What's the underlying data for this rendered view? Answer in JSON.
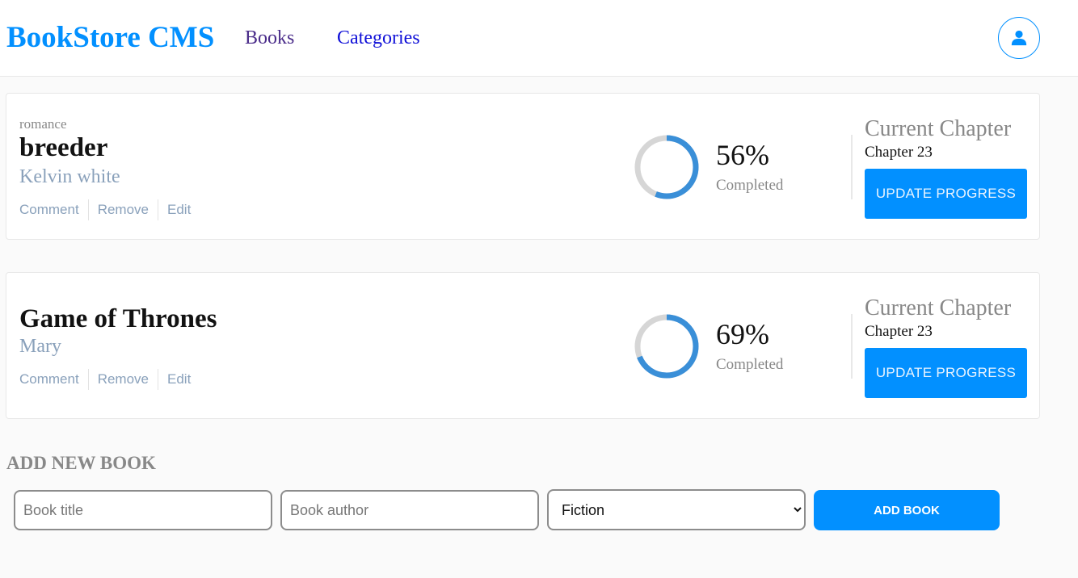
{
  "header": {
    "logo": "BookStore CMS",
    "nav": [
      {
        "label": "Books"
      },
      {
        "label": "Categories"
      }
    ],
    "user_icon": "user-icon"
  },
  "books": [
    {
      "genre": "romance",
      "title": "breeder",
      "author": "Kelvin white",
      "actions": {
        "comment": "Comment",
        "remove": "Remove",
        "edit": "Edit"
      },
      "progress": 56,
      "percent_label": "56%",
      "completed_label": "Completed",
      "chapter_label": "Current Chapter",
      "chapter_value": "Chapter 23",
      "update_label": "UPDATE PROGRESS"
    },
    {
      "genre": "",
      "title": "Game of Thrones",
      "author": "Mary",
      "actions": {
        "comment": "Comment",
        "remove": "Remove",
        "edit": "Edit"
      },
      "progress": 69,
      "percent_label": "69%",
      "completed_label": "Completed",
      "chapter_label": "Current Chapter",
      "chapter_value": "Chapter 23",
      "update_label": "UPDATE PROGRESS"
    }
  ],
  "add_form": {
    "heading": "ADD NEW BOOK",
    "title_placeholder": "Book title",
    "author_placeholder": "Book author",
    "category_selected": "Fiction",
    "submit_label": "ADD BOOK"
  },
  "colors": {
    "accent": "#0290ff",
    "ring_track": "#d6d6d6",
    "ring_progress": "#3a8fd8"
  }
}
